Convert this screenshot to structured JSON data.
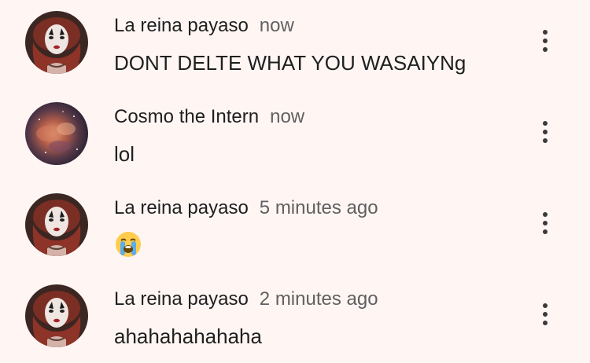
{
  "comments": [
    {
      "author": "La reina payaso",
      "time": "now",
      "text": "DONT DELTE WHAT YOU WASAIYNg",
      "avatar_icon": "clown-queen-avatar"
    },
    {
      "author": "Cosmo the Intern",
      "time": "now",
      "text": "lol",
      "avatar_icon": "nebula-avatar"
    },
    {
      "author": "La reina payaso",
      "time": "5 minutes ago",
      "text": "",
      "emoji": "loudly-crying-face",
      "avatar_icon": "clown-queen-avatar"
    },
    {
      "author": "La reina payaso",
      "time": "2 minutes ago",
      "text": "ahahahahahaha",
      "avatar_icon": "clown-queen-avatar"
    }
  ],
  "colors": {
    "background": "#fff6f4",
    "author": "#1f1f1f",
    "timestamp": "#606060"
  },
  "icons": {
    "menu": "more-vertical-icon"
  }
}
